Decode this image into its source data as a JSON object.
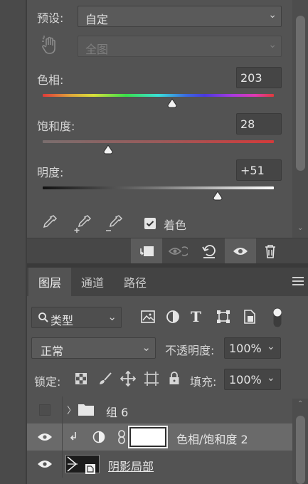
{
  "properties": {
    "preset_label": "预设:",
    "preset_value": "自定",
    "channel_value": "全图",
    "hue_label": "色相:",
    "hue_value": "203",
    "saturation_label": "饱和度:",
    "saturation_value": "28",
    "lightness_label": "明度:",
    "lightness_value": "+51",
    "colorize_label": "着色",
    "colorize_checked": true
  },
  "layers": {
    "tabs": [
      {
        "label": "图层",
        "active": true
      },
      {
        "label": "通道",
        "active": false
      },
      {
        "label": "路径",
        "active": false
      }
    ],
    "filter_kind": "类型",
    "blend_mode": "正常",
    "opacity_label": "不透明度:",
    "opacity_value": "100%",
    "lock_label": "锁定:",
    "fill_label": "填充:",
    "fill_value": "100%",
    "items": [
      {
        "name": "组 6",
        "type": "group",
        "visible": false,
        "selected": false
      },
      {
        "name": "色相/饱和度 2",
        "type": "adjustment",
        "visible": true,
        "selected": true
      },
      {
        "name": "阴影局部",
        "type": "smart-object",
        "visible": true,
        "selected": false
      }
    ]
  },
  "colors": {
    "panel_bg": "#535353",
    "selected_row": "#6a6a6a",
    "text": "#d6d6d6"
  }
}
